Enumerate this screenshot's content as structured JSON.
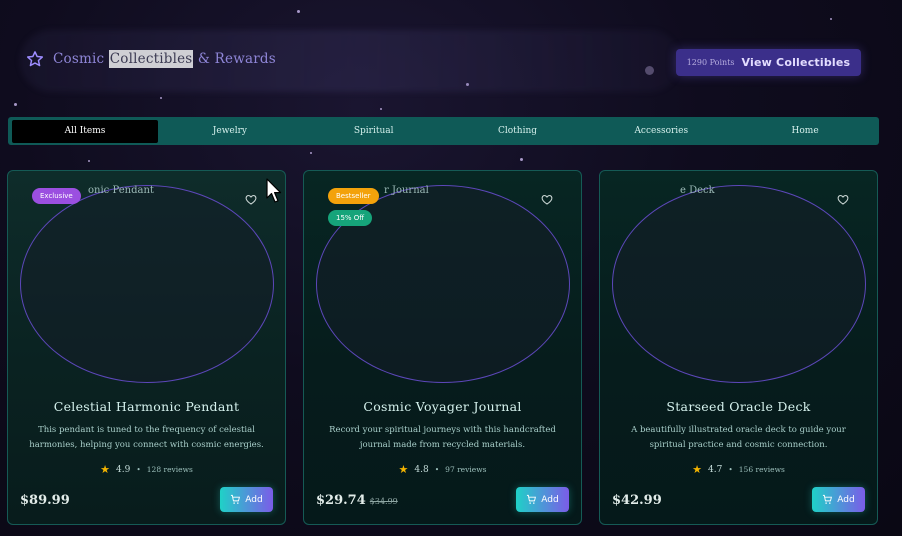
{
  "header": {
    "brand_pre": "Cosmic ",
    "brand_highlight": "Collectibles",
    "brand_post": " & Rewards",
    "points": "1290 Points",
    "view_label": "View Collectibles"
  },
  "tabs": [
    "All Items",
    "Jewelry",
    "Spiritual",
    "Clothing",
    "Accessories",
    "Home"
  ],
  "active_tab": "All Items",
  "products": [
    {
      "name_top": "onic Pendant",
      "badge": "Exclusive",
      "discount": "",
      "title": "Celestial Harmonic Pendant",
      "description": "This pendant is tuned to the frequency of celestial harmonies, helping you connect with cosmic energies.",
      "rating": "4.9",
      "reviews": "128 reviews",
      "price": "$89.99",
      "old_price": "",
      "add_label": "Add"
    },
    {
      "name_top": "r Journal",
      "badge": "Bestseller",
      "discount": "15% Off",
      "title": "Cosmic Voyager Journal",
      "description": "Record your spiritual journeys with this handcrafted journal made from recycled materials.",
      "rating": "4.8",
      "reviews": "97 reviews",
      "price": "$29.74",
      "old_price": "$34.99",
      "add_label": "Add"
    },
    {
      "name_top": "e Deck",
      "badge": "",
      "discount": "",
      "title": "Starseed Oracle Deck",
      "description": "A beautifully illustrated oracle deck to guide your spiritual practice and cosmic connection.",
      "rating": "4.7",
      "reviews": "156 reviews",
      "price": "$42.99",
      "old_price": "",
      "add_label": "Add"
    }
  ],
  "colors": {
    "accent": "#8f86d8",
    "tab_bar": "#0f5a57",
    "button_gradient_start": "#1fd1c7",
    "button_gradient_end": "#7b5ce8",
    "exclusive": "#9b4fe0",
    "bestseller": "#f3a20b",
    "discount": "#16a47a"
  },
  "icons": {
    "brand": "star-outline-icon",
    "wishlist": "heart-icon",
    "cart": "cart-icon",
    "rating": "star-filled-icon"
  }
}
